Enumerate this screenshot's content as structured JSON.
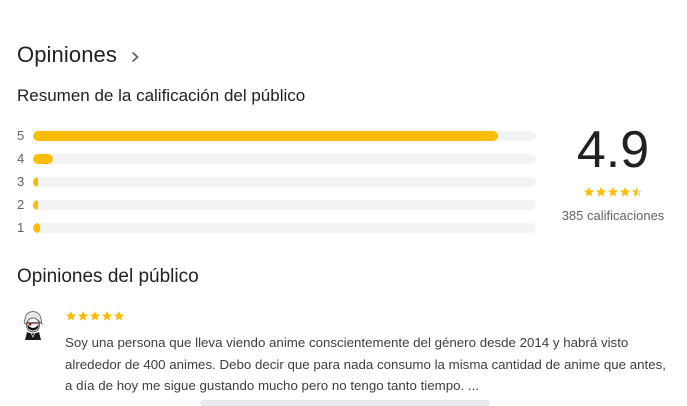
{
  "reviews": {
    "title": "Opiniones",
    "chevron_icon": "chevron-right-icon"
  },
  "summary": {
    "title": "Resumen de la calificación del público",
    "bars": [
      {
        "label": "5",
        "fraction": 0.925
      },
      {
        "label": "4",
        "fraction": 0.04
      },
      {
        "label": "3",
        "fraction": 0.005
      },
      {
        "label": "2",
        "fraction": 0.008
      },
      {
        "label": "1",
        "fraction": 0.014
      }
    ],
    "bar_color": "#fbbc04",
    "track_color": "#f1f3f4",
    "score": "4.9",
    "stars": 4.5,
    "count": "385 calificaciones"
  },
  "audience": {
    "title": "Opiniones del público",
    "review": {
      "stars": 5,
      "avatar_icon": "anime-character-avatar",
      "text": "Soy una persona que lleva viendo anime conscientemente del género desde 2014 y habrá visto alrededor de 400 animes. Debo decir que para nada consumo la misma cantidad de anime que antes, a día de hoy me sigue gustando mucho pero no tengo tanto tiempo. ..."
    }
  }
}
